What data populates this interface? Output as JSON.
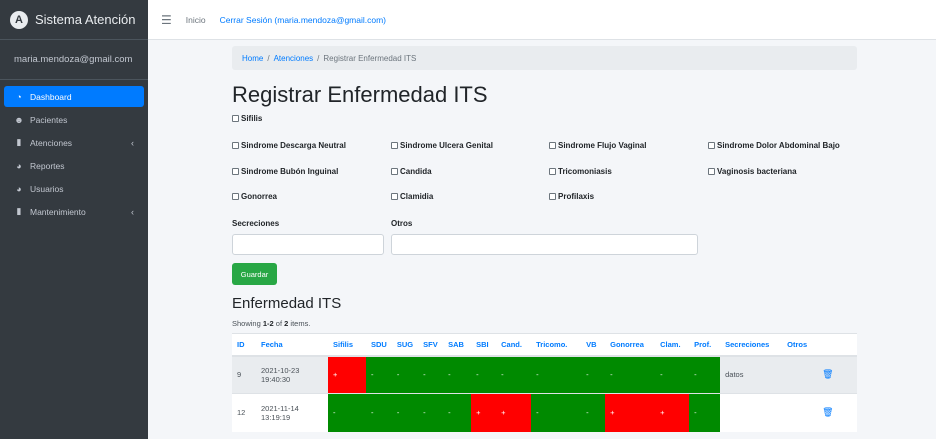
{
  "brand": {
    "title": "Sistema Atención",
    "logo_letter": "A"
  },
  "user": {
    "email": "maria.mendoza@gmail.com"
  },
  "sidebar": {
    "items": [
      {
        "label": "Dashboard",
        "icon": "dashboard-icon",
        "active": true
      },
      {
        "label": "Pacientes",
        "icon": "users-icon"
      },
      {
        "label": "Atenciones",
        "icon": "book-icon",
        "caret": "‹"
      },
      {
        "label": "Reportes",
        "icon": "chart-pie-icon"
      },
      {
        "label": "Usuarios",
        "icon": "chart-pie-icon"
      },
      {
        "label": "Mantenimiento",
        "icon": "book-icon",
        "caret": "‹"
      }
    ]
  },
  "topbar": {
    "home": "Inicio",
    "logout": "Cerrar Sesión (maria.mendoza@gmail.com)"
  },
  "breadcrumb": {
    "home": "Home",
    "section": "Atenciones",
    "current": "Registrar Enfermedad ITS"
  },
  "page_title": "Registrar Enfermedad ITS",
  "form": {
    "checkboxes": {
      "sifilis": "Sifilis",
      "sdn": "Sindrome Descarga Neutral",
      "sug": "Sindrome Ulcera Genital",
      "sfv": "Sindrome Flujo Vaginal",
      "sdab": "Sindrome Dolor Abdominal Bajo",
      "sbi": "Sindrome Bubón Inguinal",
      "candida": "Candida",
      "tricomoniasis": "Tricomoniasis",
      "vaginosis": "Vaginosis bacteriana",
      "gonorrea": "Gonorrea",
      "clamidia": "Clamidia",
      "profilaxis": "Profilaxis"
    },
    "secreciones_label": "Secreciones",
    "secreciones_value": "",
    "otros_label": "Otros",
    "otros_value": "",
    "save_label": "Guardar"
  },
  "table_title": "Enfermedad ITS",
  "summary": {
    "prefix": "Showing ",
    "range": "1-2",
    "middle": " of ",
    "total": "2",
    "suffix": " items."
  },
  "table": {
    "headers": [
      "ID",
      "Fecha",
      "Sifilis",
      "SDU",
      "SUG",
      "SFV",
      "SAB",
      "SBI",
      "Cand.",
      "Tricomo.",
      "VB",
      "Gonorrea",
      "Clam.",
      "Prof.",
      "Secreciones",
      "Otros"
    ],
    "rows": [
      {
        "id": "9",
        "fecha1": "2021-10-23",
        "fecha2": "19:40:30",
        "flags": [
          "+",
          "-",
          "-",
          "-",
          "-",
          "-",
          "-",
          "-",
          "-",
          "-",
          "-",
          "-"
        ],
        "secreciones": "datos",
        "otros": ""
      },
      {
        "id": "12",
        "fecha1": "2021-11-14",
        "fecha2": "13:19:19",
        "flags": [
          "-",
          "-",
          "-",
          "-",
          "-",
          "+",
          "+",
          "-",
          "-",
          "+",
          "+",
          "-"
        ],
        "secreciones": "",
        "otros": ""
      }
    ]
  },
  "colors": {
    "positive": "#ff0000",
    "negative": "#008a00",
    "accent": "#007bff",
    "save": "#28a745"
  }
}
